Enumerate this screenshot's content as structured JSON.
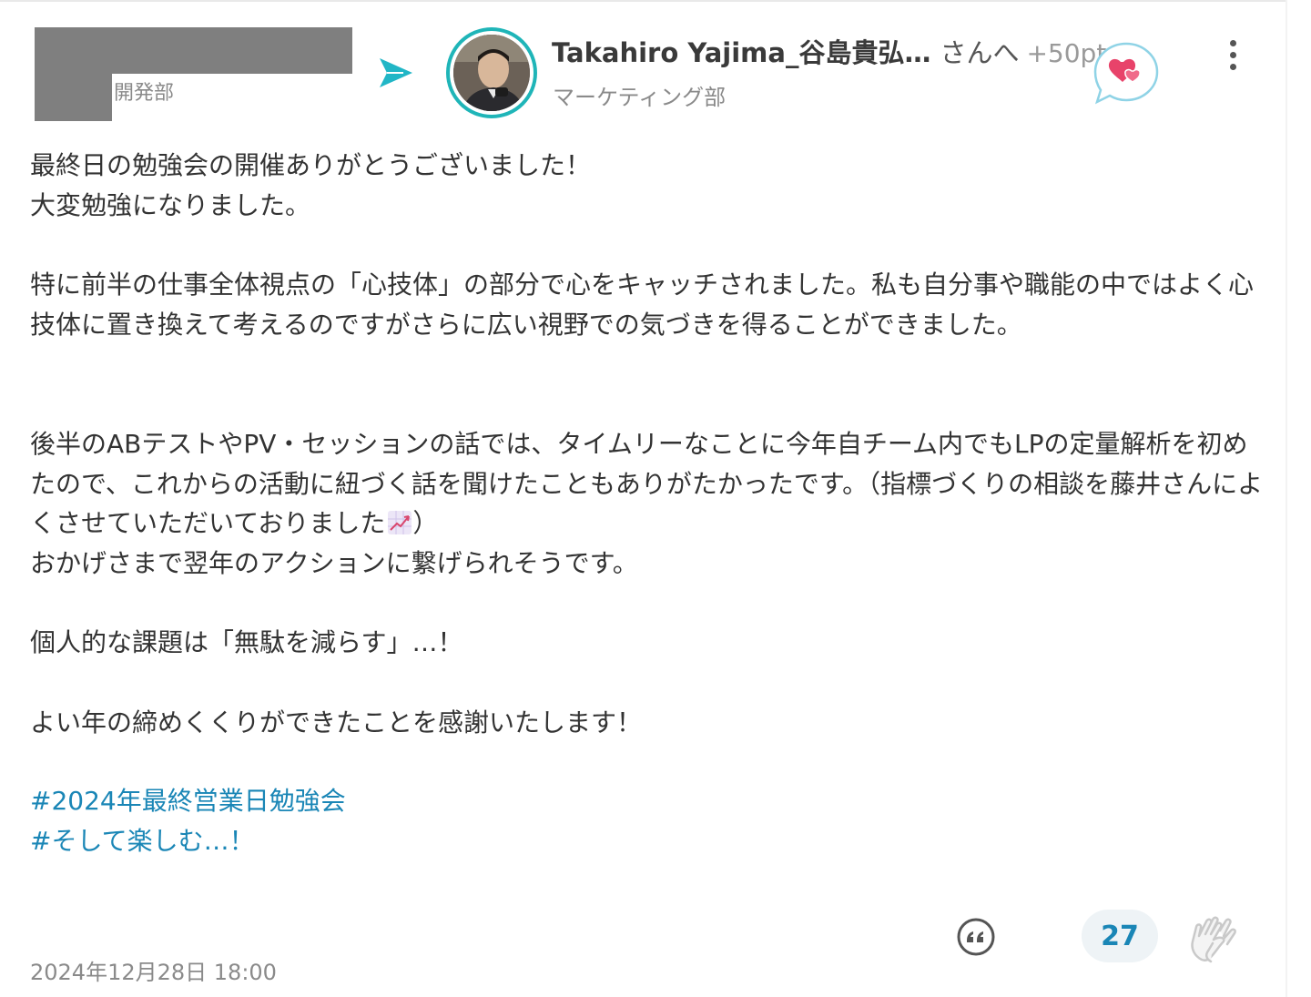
{
  "sender": {
    "department": "開発部"
  },
  "recipient": {
    "name": "Takahiro Yajima_谷島貴弘…",
    "suffix": "さんへ",
    "points": "+50pt",
    "department": "マーケティング部"
  },
  "icons": {
    "send_arrow": "send-arrow-icon",
    "heart_badge": "hearts-icon",
    "more": "more-vertical-icon",
    "quote": "quote-icon",
    "clap": "clapping-hands-icon",
    "chart_emoji": "chart-increasing-emoji"
  },
  "colors": {
    "accent": "#1fb5b8",
    "link": "#1a86b6",
    "heart": "#e8436a"
  },
  "message": {
    "p1": "最終日の勉強会の開催ありがとうございました！\n大変勉強になりました。",
    "p2": "特に前半の仕事全体視点の「心技体」の部分で心をキャッチされました。私も自分事や職能の中ではよく心技体に置き換えて考えるのですがさらに広い視野での気づきを得ることができました。",
    "p3_a": "後半のABテストやPV・セッションの話では、タイムリーなことに今年自チーム内でもLPの定量解析を初めたので、これからの活動に紐づく話を聞けたこともありがたかったです。（指標づくりの相談を藤井さんによくさせていただいておりました",
    "p3_b": "）\nおかげさまで翌年のアクションに繋げられそうです。",
    "p4": "個人的な課題は「無駄を減らす」…！",
    "p5": "よい年の締めくくりができたことを感謝いたします！"
  },
  "hashtags": [
    "#2024年最終営業日勉強会",
    "#そして楽しむ…！"
  ],
  "footer": {
    "timestamp": "2024年12月28日 18:00",
    "clap_count": "27"
  }
}
